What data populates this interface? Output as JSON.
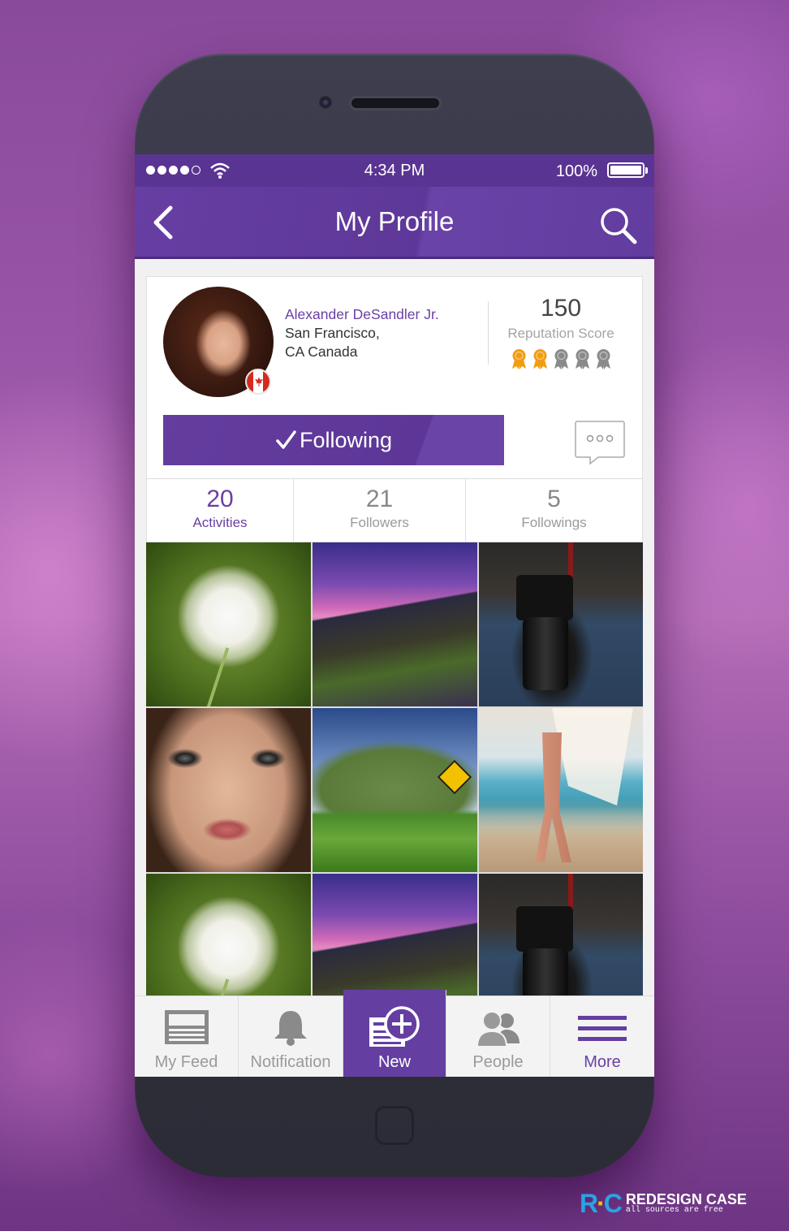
{
  "status_bar": {
    "time": "4:34 PM",
    "battery": "100%"
  },
  "nav": {
    "title": "My Profile"
  },
  "profile": {
    "name": "Alexander DeSandler Jr.",
    "location_line1": "San Francisco,",
    "location_line2": "CA Canada",
    "score_value": "150",
    "score_label": "Reputation Score",
    "badges_earned": 2,
    "badges_total": 5,
    "follow_label": "Following"
  },
  "stats": [
    {
      "num": "20",
      "label": "Activities"
    },
    {
      "num": "21",
      "label": "Followers"
    },
    {
      "num": "5",
      "label": "Followings"
    }
  ],
  "tabs": [
    {
      "label": "My Feed",
      "icon": "feed-icon"
    },
    {
      "label": "Notification",
      "icon": "bell-icon"
    },
    {
      "label": "New",
      "icon": "new-post-icon"
    },
    {
      "label": "People",
      "icon": "people-icon"
    },
    {
      "label": "More",
      "icon": "menu-icon"
    }
  ],
  "brand": {
    "title": "REDESIGN CASE",
    "subtitle": "all sources are free",
    "mark": "RC"
  },
  "colors": {
    "accent": "#653ea2",
    "badge_gold": "#f39c12",
    "badge_gray": "#8a8a8a",
    "text_muted": "#9a9a9a"
  }
}
